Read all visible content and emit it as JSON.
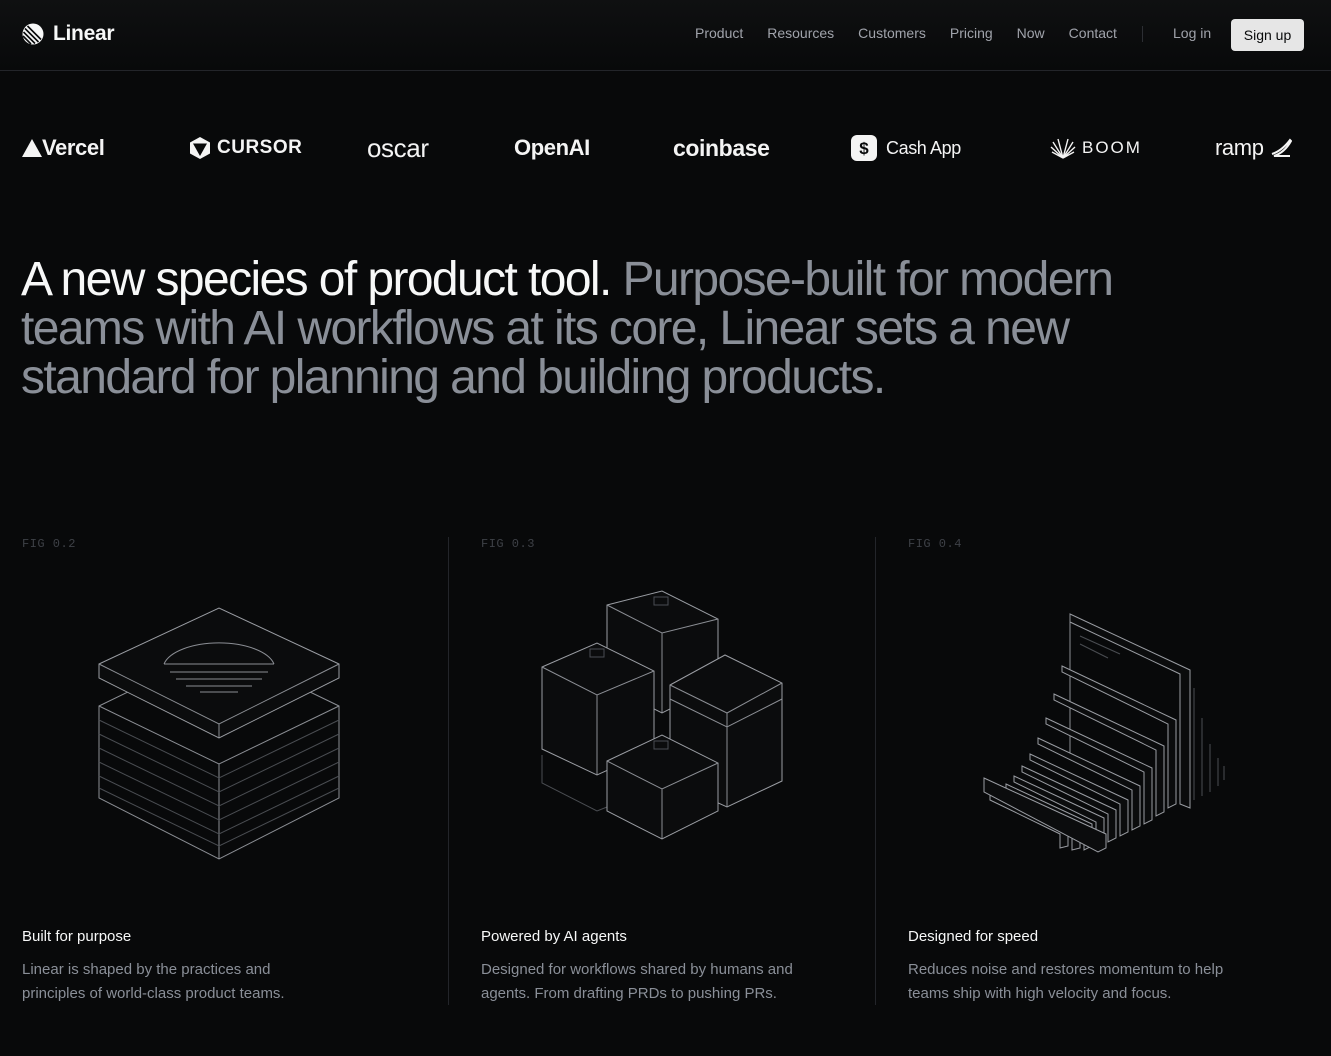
{
  "brand": {
    "name": "Linear",
    "logo_icon": "linear-logo-icon"
  },
  "nav": {
    "links": [
      "Product",
      "Resources",
      "Customers",
      "Pricing",
      "Now",
      "Contact"
    ],
    "login": "Log in",
    "signup": "Sign up"
  },
  "logos": [
    "Vercel",
    "CURSOR",
    "oscar",
    "OpenAI",
    "coinbase",
    "Cash App",
    "BOOM",
    "ramp"
  ],
  "hero": {
    "lead": "A new species of product tool.",
    "rest": " Purpose-built for modern teams with AI workflows at its core, Linear sets a new standard for planning and building products."
  },
  "features": [
    {
      "fig": "FIG 0.2",
      "title": "Built for purpose",
      "desc": "Linear is shaped by the practices and principles of world-class product teams."
    },
    {
      "fig": "FIG 0.3",
      "title": "Powered by AI agents",
      "desc": "Designed for workflows shared by humans and agents. From drafting PRDs to pushing PRs."
    },
    {
      "fig": "FIG 0.4",
      "title": "Designed for speed",
      "desc": "Reduces noise and restores momentum to help teams ship with high velocity and focus."
    }
  ],
  "colors": {
    "background": "#08090a",
    "text": "#f7f8f8",
    "muted": "#8a8f98",
    "signup_bg": "#e6e6e6"
  }
}
